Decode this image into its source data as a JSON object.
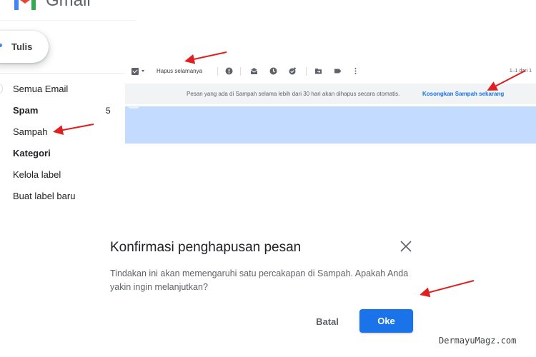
{
  "app": {
    "name": "Gmail",
    "brand_colors": {
      "red": "#ea4335",
      "blue": "#4285f4",
      "green": "#34a853",
      "yellow": "#fbbc04",
      "primary": "#1a73e8",
      "selection": "#c2dbff"
    }
  },
  "compose": {
    "label": "Tulis",
    "icon": "plus-icon"
  },
  "sidebar": {
    "items": [
      {
        "label": "Semua Email",
        "bold": false
      },
      {
        "label": "Spam",
        "bold": true,
        "count": "5"
      },
      {
        "label": "Sampah",
        "bold": false
      },
      {
        "label": "Kategori",
        "bold": true
      },
      {
        "label": "Kelola label",
        "bold": false
      },
      {
        "label": "Buat label baru",
        "bold": false
      }
    ]
  },
  "toolbar": {
    "delete_forever_label": "Hapus selamanya",
    "icons": [
      "select-checkbox-icon",
      "report-spam-icon",
      "mark-unread-icon",
      "snooze-icon",
      "add-to-tasks-icon",
      "move-to-icon",
      "label-icon",
      "more-icon"
    ],
    "range": "1–1 dari 1"
  },
  "banner": {
    "text": "Pesan yang ada di Sampah selama lebih dari 30 hari akan dihapus secara otomatis.",
    "link": "Kosongkan Sampah sekarang"
  },
  "dialog": {
    "title": "Konfirmasi penghapusan pesan",
    "body": "Tindakan ini akan memengaruhi satu percakapan di Sampah. Apakah Anda yakin ingin melanjutkan?",
    "cancel_label": "Batal",
    "ok_label": "Oke"
  },
  "annotation_color": "#e0201e",
  "watermark": "DermayuMagz.com"
}
